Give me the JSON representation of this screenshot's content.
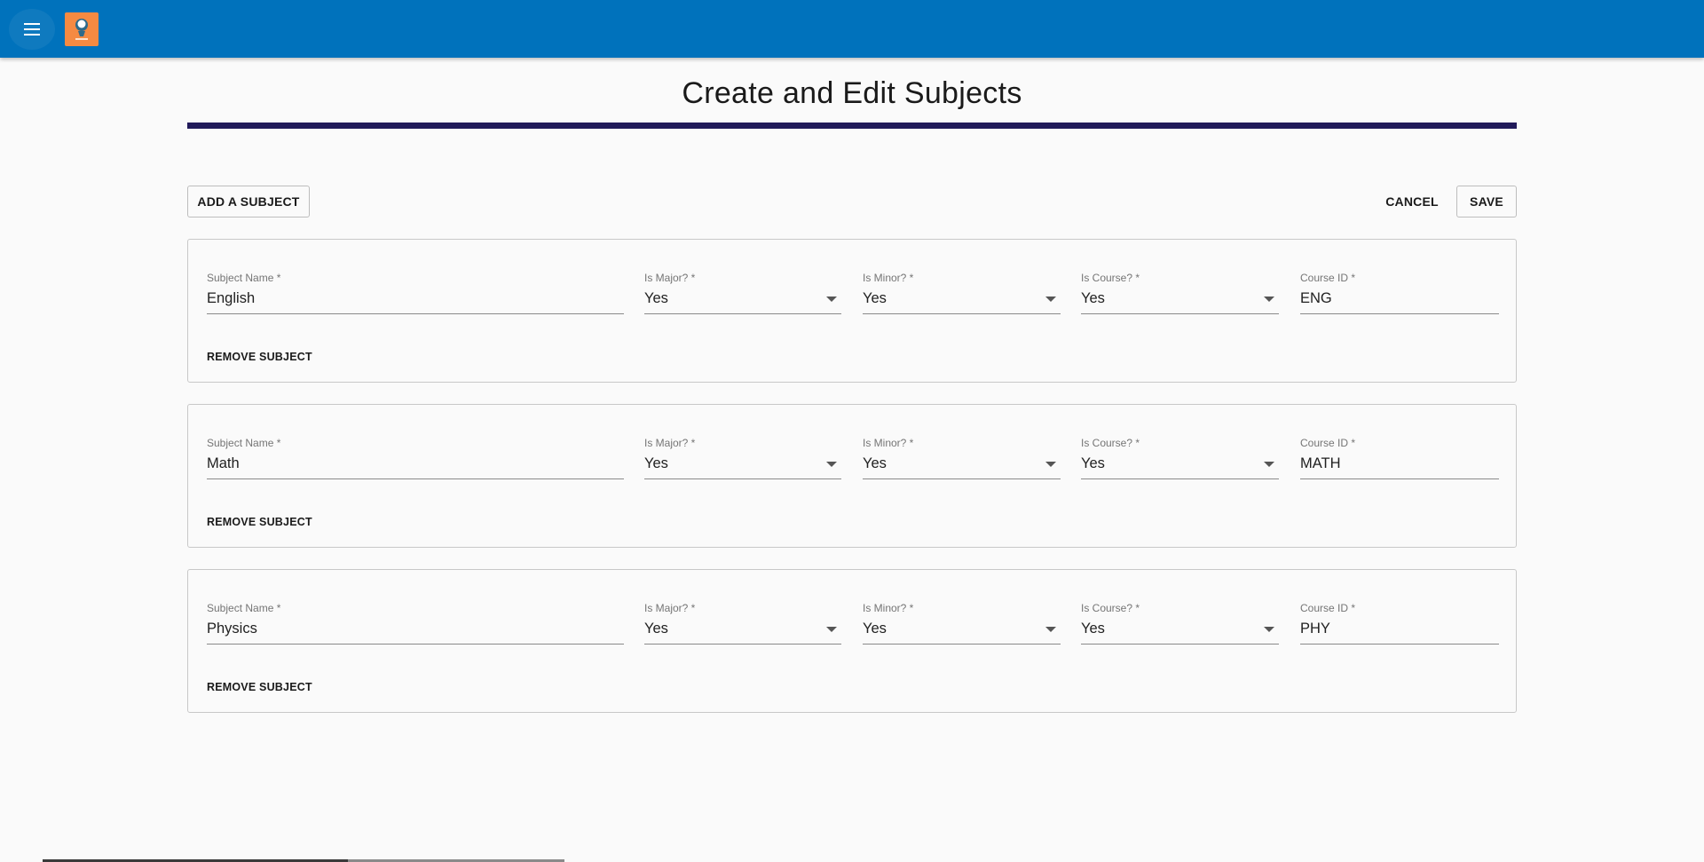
{
  "header": {
    "menu_icon": "hamburger-menu-icon",
    "logo_icon": "app-logo-icon",
    "accent_color": "#0072bc",
    "logo_color": "#f58a42"
  },
  "page": {
    "title": "Create and Edit Subjects",
    "rule_color": "#211a5a"
  },
  "toolbar": {
    "add_label": "ADD A SUBJECT",
    "cancel_label": "CANCEL",
    "save_label": "SAVE"
  },
  "field_labels": {
    "subject_name": "Subject Name *",
    "is_major": "Is Major? *",
    "is_minor": "Is Minor? *",
    "is_course": "Is Course? *",
    "course_id": "Course ID *"
  },
  "remove_label": "REMOVE SUBJECT",
  "subjects": [
    {
      "name": "English",
      "is_major": "Yes",
      "is_minor": "Yes",
      "is_course": "Yes",
      "course_id": "ENG"
    },
    {
      "name": "Math",
      "is_major": "Yes",
      "is_minor": "Yes",
      "is_course": "Yes",
      "course_id": "MATH"
    },
    {
      "name": "Physics",
      "is_major": "Yes",
      "is_minor": "Yes",
      "is_course": "Yes",
      "course_id": "PHY"
    }
  ]
}
